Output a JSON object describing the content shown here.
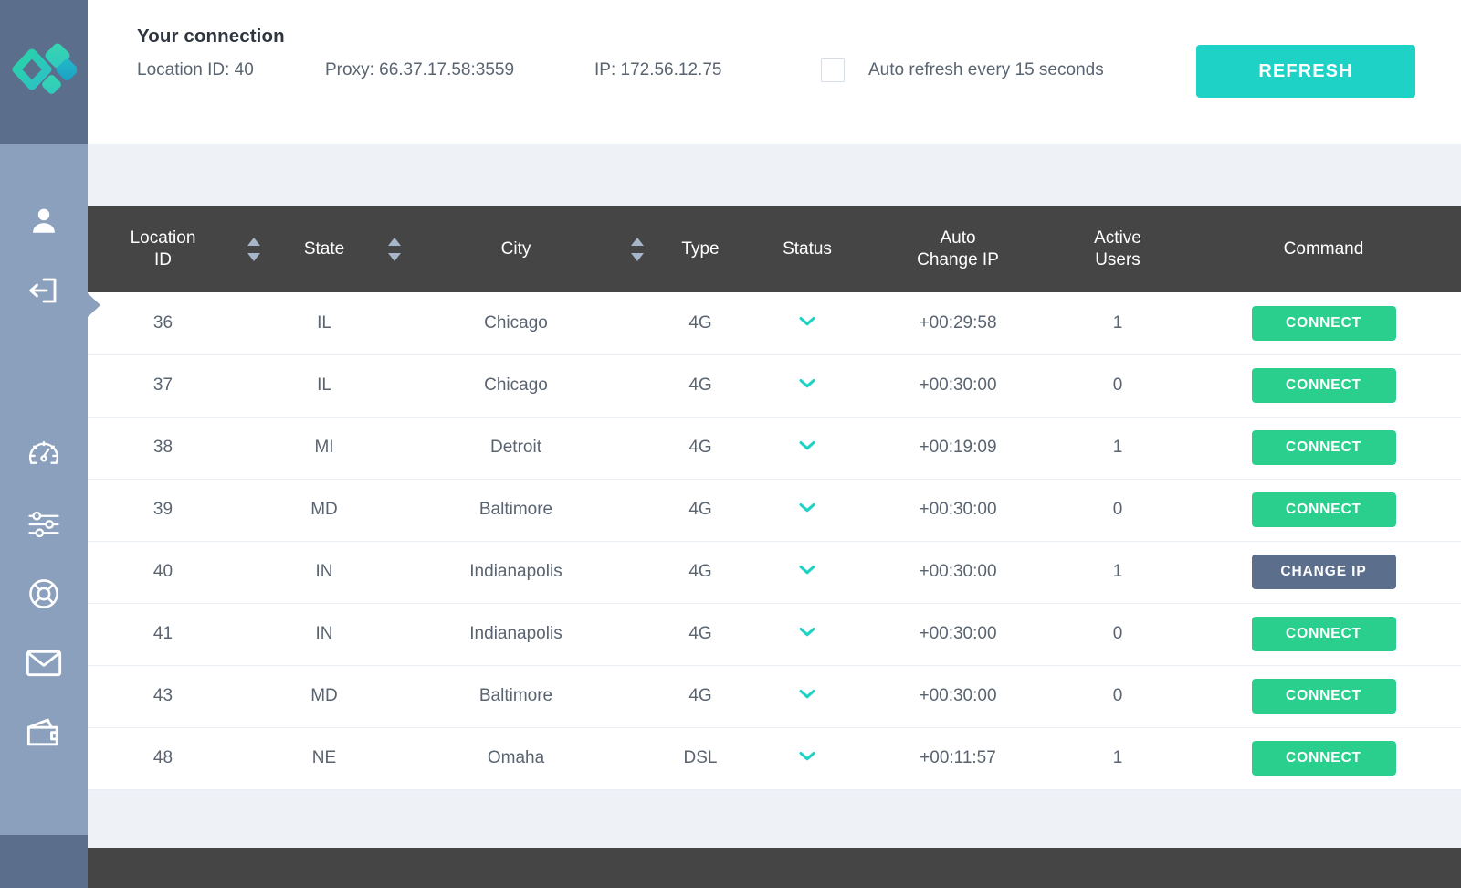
{
  "app": {
    "logo_name": "brand-diamond-logo",
    "accent_teal": "#1fd2c6",
    "accent_green": "#2bcf8d",
    "slate": "#5b6f8c",
    "sidebar_blue": "#8ba0bd",
    "header_dark": "#454545",
    "highlight_row": "#e7f3f2"
  },
  "sidebar": {
    "items": [
      {
        "name": "account-icon",
        "icon": "user"
      },
      {
        "name": "logout-icon",
        "icon": "logout"
      },
      {
        "name": "dashboard-icon",
        "icon": "speedometer"
      },
      {
        "name": "settings-icon",
        "icon": "sliders"
      },
      {
        "name": "support-icon",
        "icon": "life-ring"
      },
      {
        "name": "mail-icon",
        "icon": "envelope"
      },
      {
        "name": "billing-icon",
        "icon": "wallet"
      }
    ]
  },
  "header": {
    "title": "Your connection",
    "location_id": "Location ID: 40",
    "proxy": "Proxy: 66.37.17.58:3559",
    "ip": "IP: 172.56.12.75",
    "auto_refresh_label": "Auto refresh every 15 seconds",
    "auto_refresh_checked": false,
    "refresh_button": "REFRESH"
  },
  "table": {
    "columns": [
      "Location\nID",
      "State",
      "City",
      "Type",
      "Status",
      "Auto\nChange IP",
      "Active\nUsers",
      "Command"
    ],
    "col_location_line1": "Location",
    "col_location_line2": "ID",
    "col_state": "State",
    "col_city": "City",
    "col_type": "Type",
    "col_status": "Status",
    "col_auto_line1": "Auto",
    "col_auto_line2": "Change IP",
    "col_users_line1": "Active",
    "col_users_line2": "Users",
    "col_command": "Command",
    "rows": [
      {
        "location_id": "36",
        "state": "IL",
        "city": "Chicago",
        "type": "4G",
        "status": "ok",
        "auto_change_ip": "+00:29:58",
        "active_users": "1",
        "command": "CONNECT",
        "command_kind": "connect",
        "highlight": false,
        "pointer": true
      },
      {
        "location_id": "37",
        "state": "IL",
        "city": "Chicago",
        "type": "4G",
        "status": "ok",
        "auto_change_ip": "+00:30:00",
        "active_users": "0",
        "command": "CONNECT",
        "command_kind": "connect",
        "highlight": false,
        "pointer": false
      },
      {
        "location_id": "38",
        "state": "MI",
        "city": "Detroit",
        "type": "4G",
        "status": "ok",
        "auto_change_ip": "+00:19:09",
        "active_users": "1",
        "command": "CONNECT",
        "command_kind": "connect",
        "highlight": true,
        "pointer": false
      },
      {
        "location_id": "39",
        "state": "MD",
        "city": "Baltimore",
        "type": "4G",
        "status": "ok",
        "auto_change_ip": "+00:30:00",
        "active_users": "0",
        "command": "CONNECT",
        "command_kind": "connect",
        "highlight": false,
        "pointer": false
      },
      {
        "location_id": "40",
        "state": "IN",
        "city": "Indianapolis",
        "type": "4G",
        "status": "ok",
        "auto_change_ip": "+00:30:00",
        "active_users": "1",
        "command": "CHANGE IP",
        "command_kind": "change",
        "highlight": false,
        "pointer": false
      },
      {
        "location_id": "41",
        "state": "IN",
        "city": "Indianapolis",
        "type": "4G",
        "status": "ok",
        "auto_change_ip": "+00:30:00",
        "active_users": "0",
        "command": "CONNECT",
        "command_kind": "connect",
        "highlight": false,
        "pointer": false
      },
      {
        "location_id": "43",
        "state": "MD",
        "city": "Baltimore",
        "type": "4G",
        "status": "ok",
        "auto_change_ip": "+00:30:00",
        "active_users": "0",
        "command": "CONNECT",
        "command_kind": "connect",
        "highlight": false,
        "pointer": false
      },
      {
        "location_id": "48",
        "state": "NE",
        "city": "Omaha",
        "type": "DSL",
        "status": "ok",
        "auto_change_ip": "+00:11:57",
        "active_users": "1",
        "command": "CONNECT",
        "command_kind": "connect",
        "highlight": false,
        "pointer": false
      }
    ]
  }
}
